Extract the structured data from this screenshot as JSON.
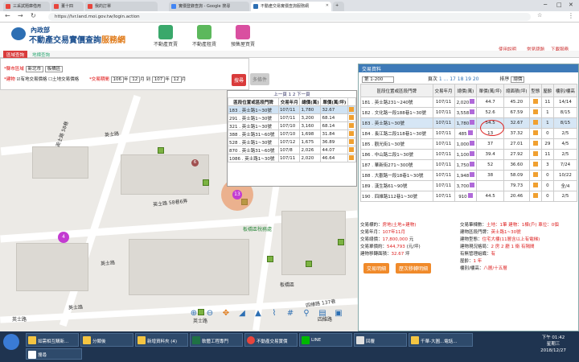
{
  "browser": {
    "tabs": [
      {
        "label": "三采試題庫借用",
        "active": false
      },
      {
        "label": "董十四",
        "active": false
      },
      {
        "label": "我的訂單",
        "active": false
      },
      {
        "label": "實價登錄查詢 - Google 搜尋",
        "active": false
      },
      {
        "label": "不動產交易實價查詢服務網",
        "active": true
      }
    ],
    "url": "https://lvr.land.moi.gov.tw/login.action"
  },
  "site": {
    "logo_line1": "內政部",
    "logo_line2_a": "不動產交易實價查詢",
    "logo_line2_b": "服務網",
    "nav": [
      "不動產買賣",
      "不動產租賃",
      "預售屋買賣"
    ],
    "user_links": [
      "使用說明",
      "常見問題",
      "下載服務"
    ],
    "subtabs": [
      "區域查詢",
      "地標查詢"
    ]
  },
  "search": {
    "city_label": "*縣市區域",
    "city": "新北市",
    "district": "板橋區",
    "filters": [
      "*建物",
      "有地交易價格",
      "土地交易價格"
    ],
    "period_label": "*交易期間",
    "from_year": "106",
    "from_month": "12",
    "to_year": "107",
    "to_month": "12",
    "year_unit": "年",
    "month_unit": "月",
    "to_sep": "到",
    "search_btn": "搜尋",
    "multi_btn": "多條件"
  },
  "popup_list": {
    "pager": "上一頁  1  2  下一頁",
    "headers": [
      "區段位置或區段門牌",
      "交易年月",
      "總價(萬)",
      "單價(萬/坪)",
      ""
    ],
    "rows": [
      {
        "addr": "183 . 英士路1~30號",
        "ym": "107/11",
        "total": "1,780",
        "unit": "32.67",
        "hl": true
      },
      {
        "addr": "291 . 英士路1~30號",
        "ym": "107/11",
        "total": "3,200",
        "unit": "68.14",
        "hl": false
      },
      {
        "addr": "321 . 英士路1~30號",
        "ym": "107/10",
        "total": "3,160",
        "unit": "68.14",
        "hl": false
      },
      {
        "addr": "388 . 英士路31~60號",
        "ym": "107/10",
        "total": "1,698",
        "unit": "31.84",
        "hl": false
      },
      {
        "addr": "528 . 英士路1~30號",
        "ym": "107/12",
        "total": "1,675",
        "unit": "36.89",
        "hl": false
      },
      {
        "addr": "870 . 英士路31~60號",
        "ym": "107/8",
        "total": "2,026",
        "unit": "44.07",
        "hl": false
      },
      {
        "addr": "1086 . 英士路1~30號",
        "ym": "107/11",
        "total": "2,020",
        "unit": "46.64",
        "hl": false
      }
    ]
  },
  "map_labels": [
    "英士路 58巷",
    "英士路",
    "英士路 58巷6弄",
    "英士路",
    "英士路",
    "板橋區稅務處",
    "四維路 137巷",
    "四維路",
    "英士路",
    "板橋區",
    "英士路"
  ],
  "map_clusters": [
    "13",
    "4",
    "6"
  ],
  "panel": {
    "title": "交易資料",
    "range": "第 1-200",
    "pager_prefix": "頁次",
    "pages": "1 ... 17 18 19 20",
    "sort_label": "排序",
    "sort_value": "總價",
    "headers": [
      "區段位置或區段門牌",
      "交易年月",
      "總價(萬)",
      "單價(萬/坪)",
      "總面積(坪)",
      "型態",
      "屋齡",
      "樓別/樓高"
    ],
    "rows": [
      {
        "addr": "181 . 英士路231~240號",
        "ym": "107/11",
        "total": "2,020",
        "unit": "44.7",
        "area": "45.20",
        "age": "11",
        "floor": "14/14",
        "hl": false
      },
      {
        "addr": "182 . 文化路一段188巷1~30號",
        "ym": "107/11",
        "total": "3,558",
        "unit": "52.6",
        "area": "67.59",
        "age": "1",
        "floor": "8/15",
        "hl": false
      },
      {
        "addr": "183 . 英士路1~30號",
        "ym": "107/11",
        "total": "1,780",
        "unit": "54.5",
        "area": "32.67",
        "age": "1",
        "floor": "8/15",
        "hl": true
      },
      {
        "addr": "184 . 長江路二段118巷1~30號",
        "ym": "107/11",
        "total": "485",
        "unit": "13",
        "area": "37.32",
        "age": "0",
        "floor": "2/5",
        "hl": false
      },
      {
        "addr": "185 . 觀光街1~30號",
        "ym": "107/11",
        "total": "1,000",
        "unit": "37",
        "area": "27.01",
        "age": "29",
        "floor": "4/5",
        "hl": false
      },
      {
        "addr": "186 . 中山路二段1~30號",
        "ym": "107/11",
        "total": "1,100",
        "unit": "39.4",
        "area": "27.92",
        "age": "11",
        "floor": "2/5",
        "hl": false
      },
      {
        "addr": "187 . 華新街271~300號",
        "ym": "107/11",
        "total": "1,750",
        "unit": "52",
        "area": "36.60",
        "age": "3",
        "floor": "7/24",
        "hl": false
      },
      {
        "addr": "188 . 大觀路一段18巷1~30號",
        "ym": "107/11",
        "total": "1,948",
        "unit": "38",
        "area": "58.09",
        "age": "0",
        "floor": "10/22",
        "hl": false
      },
      {
        "addr": "189 . 漢生路61~90號",
        "ym": "107/11",
        "total": "3,700",
        "unit": "",
        "area": "79.73",
        "age": "0",
        "floor": "全/4",
        "hl": false
      },
      {
        "addr": "190 . 四維路112巷1~30號",
        "ym": "107/11",
        "total": "910",
        "unit": "44.5",
        "area": "20.46",
        "age": "0",
        "floor": "2/5",
        "hl": false
      }
    ],
    "detail_left": [
      {
        "k": "交易標的：",
        "v": "房地(土地+建物)"
      },
      {
        "k": "交易年月：",
        "v": "107年11月"
      },
      {
        "k": "交易總價：",
        "v": "17,800,000",
        "u": "元"
      },
      {
        "k": "交易單價約：",
        "v": "544,793",
        "u": "(元/坪)"
      },
      {
        "k": "建物移轉面積：",
        "v": "32.67",
        "u": "坪"
      }
    ],
    "detail_right": [
      {
        "k": "交易筆棟數：",
        "v": "土地：1筆 建物：1棟(戶) 車位：0個"
      },
      {
        "k": "建物區段門牌：",
        "v": "英士路1~30號"
      },
      {
        "k": "建物型態：",
        "v": "住宅大樓(11層含以上有電梯)"
      },
      {
        "k": "建物現況格局：",
        "v": "2 房 2 廳 1 衛 有隔間"
      },
      {
        "k": "有無管理組織：",
        "v": "有"
      },
      {
        "k": "屋齡：",
        "v": "1 年"
      },
      {
        "k": "樓別/樓高：",
        "v": "八層/十五層"
      },
      {
        "k": "建物使用：",
        "v": ""
      }
    ],
    "btn_detail": "交易明細",
    "btn_history": "歷次移轉明細"
  },
  "taskbar": {
    "items": [
      "如需相互購新...",
      "分類後",
      "新增資料夾 (4)",
      "軟體工程專門",
      "不動產交易實價",
      "LINE",
      "回覆",
      "千華-大圖...電話..."
    ],
    "search": "搜尋",
    "time": "下午 01:42",
    "day": "星期三",
    "date": "2018/12/27"
  },
  "colors": {
    "accent": "#3d7ab8",
    "brand": "#1b4f8f",
    "search": "#d93b3b",
    "highlight": "#cfe2f3"
  }
}
